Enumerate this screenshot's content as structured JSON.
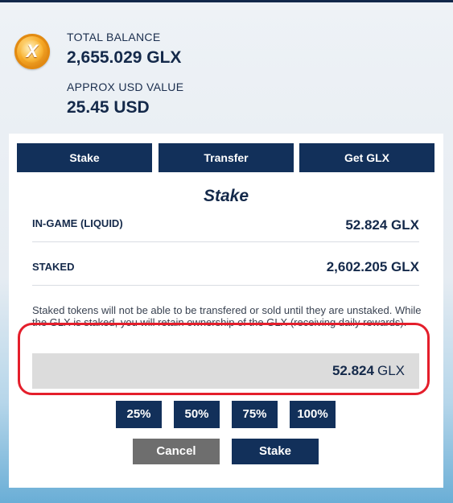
{
  "balance": {
    "total_label": "TOTAL BALANCE",
    "total_value": "2,655.029 GLX",
    "usd_label": "APPROX USD VALUE",
    "usd_value": "25.45 USD"
  },
  "tabs": [
    {
      "label": "Stake"
    },
    {
      "label": "Transfer"
    },
    {
      "label": "Get GLX"
    }
  ],
  "stake": {
    "title": "Stake",
    "rows": [
      {
        "label": "IN-GAME (LIQUID)",
        "value": "52.824 GLX"
      },
      {
        "label": "STAKED",
        "value": "2,602.205 GLX"
      }
    ],
    "notice": "Staked tokens will not be able to be transfered or sold until they are unstaked. While the GLX is staked, you will retain ownership of the GLX (receiving daily rewards).",
    "amount": "52.824",
    "amount_unit": "GLX",
    "percent_buttons": [
      {
        "label": "25%"
      },
      {
        "label": "50%"
      },
      {
        "label": "75%"
      },
      {
        "label": "100%"
      }
    ],
    "cancel_label": "Cancel",
    "submit_label": "Stake"
  },
  "colors": {
    "navy": "#12305a",
    "cancel_gray": "#6e6e6e",
    "highlight_red": "#e41e2b"
  }
}
